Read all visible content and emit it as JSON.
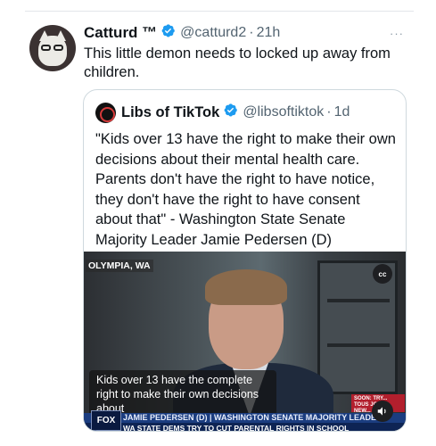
{
  "tweet": {
    "author_name": "Catturd ™",
    "author_handle": "@catturd2",
    "separator": "·",
    "time": "21h",
    "more_label": "···",
    "text": "This little demon needs to locked up away from children."
  },
  "quoted": {
    "author_name": "Libs of TikTok",
    "author_handle": "@libsoftiktok",
    "separator": "·",
    "time": "1d",
    "text": "\"Kids over 13 have the right to make their own decisions about their mental health care. Parents don't have the right to have notice, they don't have the right to have consent about that\" - Washington State Senate Majority Leader Jamie Pedersen (D)"
  },
  "video": {
    "location_label": "OLYMPIA, WA",
    "cc_label": "cc",
    "caption": "Kids over 13 have the complete right to make their own decisions about",
    "chyron": "JAMIE PEDERSEN (D) | WASHINGTON SENATE MAJORITY LEADER",
    "ticker": "WA STATE DEMS TRY TO CUT PARENTAL RIGHTS IN SCHOOL",
    "network_logo": "FOX",
    "promo": "SOON: TRY... TOUS JOINT NEW... NCE"
  },
  "colors": {
    "verified_blue": "#1d9bf0",
    "text_primary": "#0f1419",
    "text_secondary": "#536471",
    "border": "#cfd9de"
  }
}
